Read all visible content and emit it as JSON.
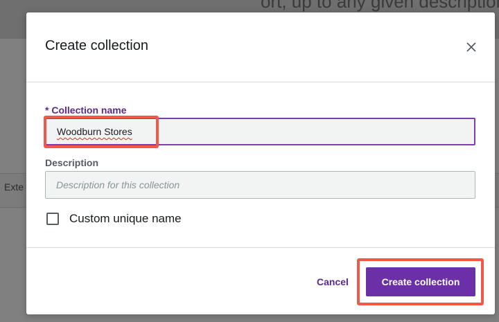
{
  "background": {
    "top_text": "ort, up to any given description",
    "partial_tab_text": "Exte"
  },
  "modal": {
    "title": "Create collection",
    "close_icon": "close-icon",
    "fields": {
      "name_required_marker": "*",
      "name_label": "Collection name",
      "name_value": "Woodburn Stores",
      "description_label": "Description",
      "description_placeholder": "Description for this collection"
    },
    "checkbox": {
      "label": "Custom unique name",
      "checked": false
    },
    "footer": {
      "cancel_label": "Cancel",
      "create_label": "Create collection"
    }
  },
  "colors": {
    "accent": "#6b2fa8",
    "focus_border": "#7a3db3",
    "highlight": "#f0584a",
    "overlay": "#7d7d7d"
  }
}
